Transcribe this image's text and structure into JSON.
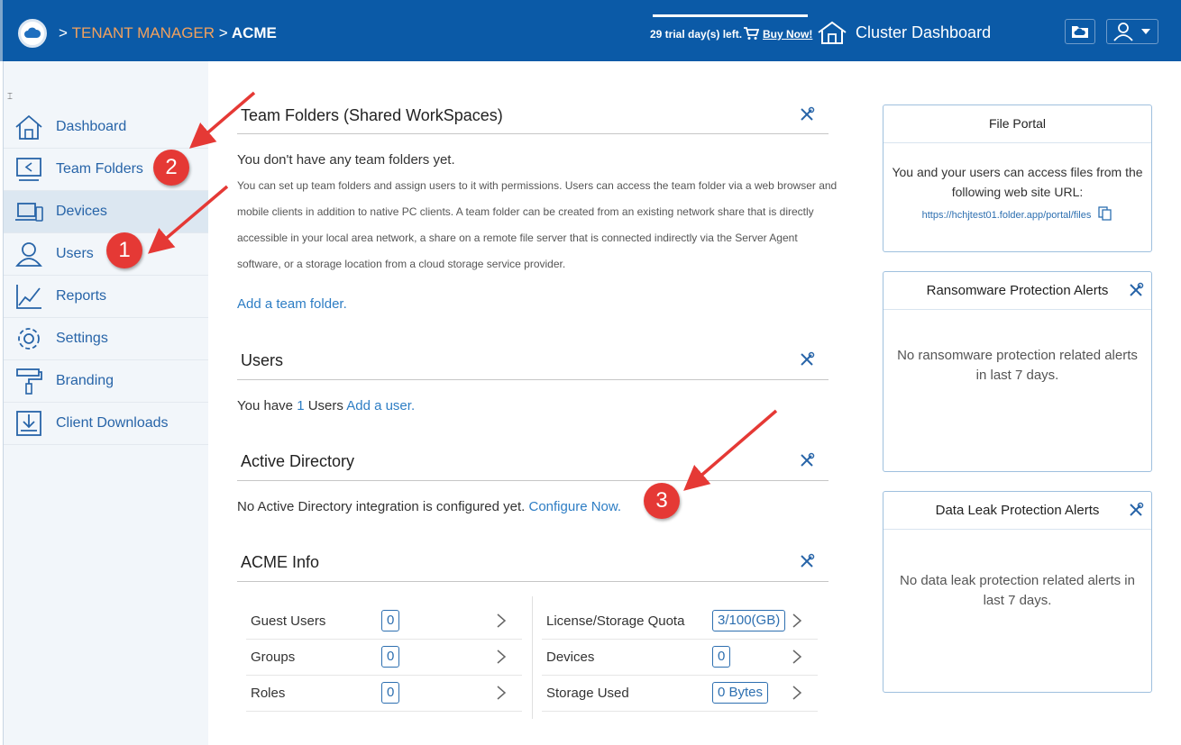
{
  "header": {
    "sep1": ">",
    "tenant_manager": "TENANT MANAGER",
    "sep2": ">",
    "tenant": "ACME",
    "trial_text": "29 trial day(s) left.",
    "buy_now": "Buy Now!",
    "cluster_dashboard": "Cluster Dashboard",
    "icons": [
      "cloud-logo-icon",
      "cart-icon",
      "house-icon",
      "folder-icon",
      "user-menu-icon"
    ]
  },
  "sidebar": {
    "collapse_glyph": "⌶",
    "items": [
      {
        "label": "Dashboard",
        "icon": "home-icon",
        "active": false
      },
      {
        "label": "Team Folders",
        "icon": "team-folder-icon",
        "active": false
      },
      {
        "label": "Devices",
        "icon": "devices-icon",
        "active": true
      },
      {
        "label": "Users",
        "icon": "users-icon",
        "active": false
      },
      {
        "label": "Reports",
        "icon": "reports-icon",
        "active": false
      },
      {
        "label": "Settings",
        "icon": "gear-icon",
        "active": false
      },
      {
        "label": "Branding",
        "icon": "paint-roller-icon",
        "active": false
      },
      {
        "label": "Client Downloads",
        "icon": "download-icon",
        "active": false
      }
    ]
  },
  "team_folders": {
    "title": "Team Folders (Shared WorkSpaces)",
    "empty": "You don't have any team folders yet.",
    "desc_lines": [
      "You can set up team folders and assign users to it with permissions. Users can access the team folder via a web browser and",
      "mobile clients in addition to native PC clients. A team folder can be created from an existing network share that is directly",
      "accessible in your local area network, a share on a remote file server that is connected indirectly via the Server Agent",
      "software, or a storage location from a cloud storage service provider."
    ],
    "add_link": "Add a team folder."
  },
  "users": {
    "title": "Users",
    "prefix": "You have",
    "count": "1",
    "suffix": "Users",
    "add_link": "Add a user."
  },
  "active_directory": {
    "title": "Active Directory",
    "text": "No Active Directory integration is configured yet.",
    "configure_link": "Configure Now."
  },
  "info": {
    "title": "ACME Info",
    "left": [
      {
        "label": "Guest Users",
        "value": "0"
      },
      {
        "label": "Groups",
        "value": "0"
      },
      {
        "label": "Roles",
        "value": "0"
      }
    ],
    "right": [
      {
        "label": "License/Storage Quota",
        "value": "3/100(GB)"
      },
      {
        "label": "Devices",
        "value": "0"
      },
      {
        "label": "Storage Used",
        "value": "0 Bytes"
      }
    ]
  },
  "file_portal": {
    "title": "File Portal",
    "line1": "You and your users can access files from the",
    "line2": "following web site URL:",
    "url": "https://hchjtest01.folder.app/portal/files"
  },
  "ransomware": {
    "title": "Ransomware Protection Alerts",
    "line1": "No ransomware protection related alerts",
    "line2": "in last 7 days."
  },
  "dataleak": {
    "title": "Data Leak Protection Alerts",
    "line1": "No data leak protection related alerts in",
    "line2": "last 7 days."
  },
  "annotations": {
    "markers": [
      "1",
      "2",
      "3"
    ],
    "color": "#e53935"
  },
  "colors": {
    "header_bg": "#0b5aa7",
    "accent_orange": "#f2a15d",
    "link_blue": "#2d7dc4",
    "sidebar_bg": "#f2f6fa"
  }
}
